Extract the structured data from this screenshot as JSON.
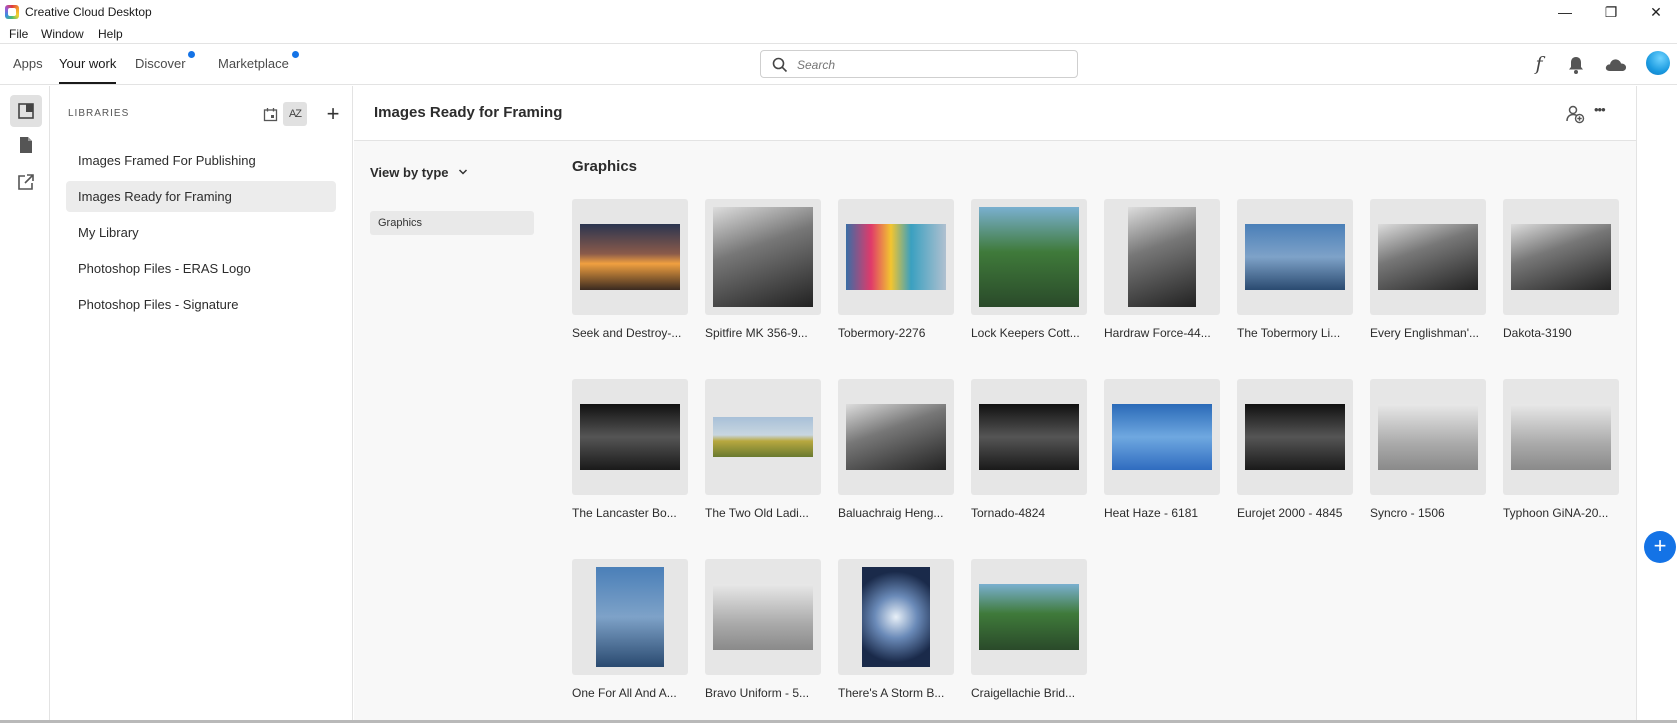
{
  "window": {
    "title": "Creative Cloud Desktop",
    "minimize": "—",
    "restore": "❐",
    "close": "✕"
  },
  "menu": {
    "file": "File",
    "window": "Window",
    "help": "Help"
  },
  "nav": {
    "tabs": [
      {
        "label": "Apps",
        "active": false,
        "has_dot": false
      },
      {
        "label": "Your work",
        "active": true,
        "has_dot": false
      },
      {
        "label": "Discover",
        "active": false,
        "has_dot": true
      },
      {
        "label": "Marketplace",
        "active": false,
        "has_dot": true
      }
    ],
    "search_placeholder": "Search",
    "fonts_icon_glyph": "f",
    "accent_color": "#1473e6"
  },
  "sidebar": {
    "heading": "LIBRARIES",
    "add_glyph": "+",
    "sort_glyph": "AZ",
    "items": [
      {
        "label": "Images Framed For Publishing",
        "selected": false
      },
      {
        "label": "Images Ready for Framing",
        "selected": true
      },
      {
        "label": "My Library",
        "selected": false
      },
      {
        "label": "Photoshop Files - ERAS Logo",
        "selected": false
      },
      {
        "label": "Photoshop Files - Signature",
        "selected": false
      }
    ]
  },
  "main": {
    "title": "Images Ready for Framing",
    "more_glyph": "•••",
    "view_by": "View by type",
    "type_filter": "Graphics",
    "section_title": "Graphics",
    "assets": [
      {
        "name": "Seek and Destroy-...",
        "orientation": "landscape",
        "theme": "sunset"
      },
      {
        "name": "Spitfire MK 356-9...",
        "orientation": "square",
        "theme": "bw"
      },
      {
        "name": "Tobermory-2276",
        "orientation": "landscape",
        "theme": "colorful"
      },
      {
        "name": "Lock Keepers Cott...",
        "orientation": "square",
        "theme": "green"
      },
      {
        "name": "Hardraw Force-44...",
        "orientation": "portrait",
        "theme": "bw"
      },
      {
        "name": "The Tobermory Li...",
        "orientation": "landscape",
        "theme": "blue"
      },
      {
        "name": "Every Englishman'...",
        "orientation": "landscape",
        "theme": "bw"
      },
      {
        "name": "Dakota-3190",
        "orientation": "landscape",
        "theme": "bw"
      },
      {
        "name": "The Lancaster Bo...",
        "orientation": "landscape",
        "theme": "dark"
      },
      {
        "name": "The Two Old Ladi...",
        "orientation": "wide",
        "theme": "field"
      },
      {
        "name": "Baluachraig Heng...",
        "orientation": "landscape",
        "theme": "bw"
      },
      {
        "name": "Tornado-4824",
        "orientation": "landscape",
        "theme": "dark"
      },
      {
        "name": "Heat Haze - 6181",
        "orientation": "landscape",
        "theme": "sky"
      },
      {
        "name": "Eurojet 2000 - 4845",
        "orientation": "landscape",
        "theme": "dark"
      },
      {
        "name": "Syncro - 1506",
        "orientation": "landscape",
        "theme": "grey"
      },
      {
        "name": "Typhoon GiNA-20...",
        "orientation": "landscape",
        "theme": "grey"
      },
      {
        "name": "One For All And A...",
        "orientation": "portrait",
        "theme": "blue"
      },
      {
        "name": "Bravo Uniform - 5...",
        "orientation": "landscape",
        "theme": "grey"
      },
      {
        "name": "There's A Storm B...",
        "orientation": "portrait",
        "theme": "storm"
      },
      {
        "name": "Craigellachie Brid...",
        "orientation": "landscape",
        "theme": "green"
      }
    ]
  },
  "fab_glyph": "+"
}
